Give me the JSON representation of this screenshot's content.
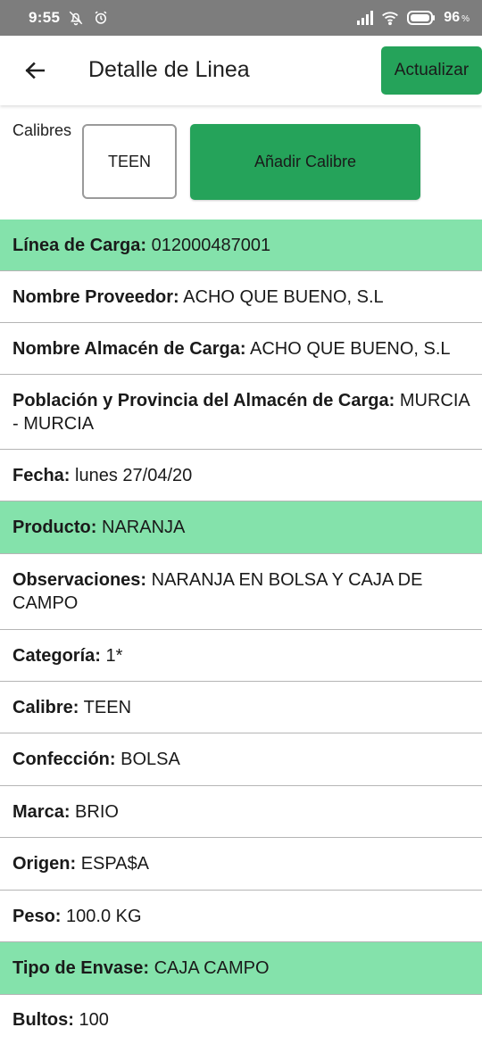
{
  "status_bar": {
    "time": "9:55",
    "battery_percent": "96",
    "battery_unit": "%",
    "icons": [
      "notifications-off-icon",
      "alarm-icon",
      "signal-icon",
      "wifi-icon",
      "battery-icon"
    ]
  },
  "app_bar": {
    "title": "Detalle de Linea",
    "update_label": "Actualizar",
    "back_icon": "arrow-back-icon"
  },
  "calibres": {
    "label": "Calibres",
    "chips": [
      "TEEN"
    ],
    "add_label": "Añadir Calibre"
  },
  "colors": {
    "accent_green": "#25a35a",
    "highlight_green": "#84e2ab",
    "status_bar": "#7d7d7d"
  },
  "details": [
    {
      "label": "Línea de Carga:",
      "value": "012000487001",
      "highlight": true
    },
    {
      "label": "Nombre Proveedor:",
      "value": "ACHO QUE BUENO, S.L",
      "highlight": false
    },
    {
      "label": "Nombre Almacén de Carga:",
      "value": "ACHO QUE BUENO, S.L",
      "highlight": false
    },
    {
      "label": "Población y Provincia del Almacén de Carga:",
      "value": "MURCIA - MURCIA",
      "highlight": false
    },
    {
      "label": "Fecha:",
      "value": "lunes 27/04/20",
      "highlight": false
    },
    {
      "label": "Producto:",
      "value": "NARANJA",
      "highlight": true
    },
    {
      "label": "Observaciones:",
      "value": "NARANJA EN BOLSA Y CAJA DE CAMPO",
      "highlight": false
    },
    {
      "label": "Categoría:",
      "value": "1*",
      "highlight": false
    },
    {
      "label": "Calibre:",
      "value": "TEEN",
      "highlight": false
    },
    {
      "label": "Confección:",
      "value": "BOLSA",
      "highlight": false
    },
    {
      "label": "Marca:",
      "value": "BRIO",
      "highlight": false
    },
    {
      "label": "Origen:",
      "value": "ESPA$A",
      "highlight": false
    },
    {
      "label": "Peso:",
      "value": "100.0 KG",
      "highlight": false
    },
    {
      "label": "Tipo de Envase:",
      "value": "CAJA CAMPO",
      "highlight": true
    },
    {
      "label": "Bultos:",
      "value": "100",
      "highlight": false
    }
  ]
}
